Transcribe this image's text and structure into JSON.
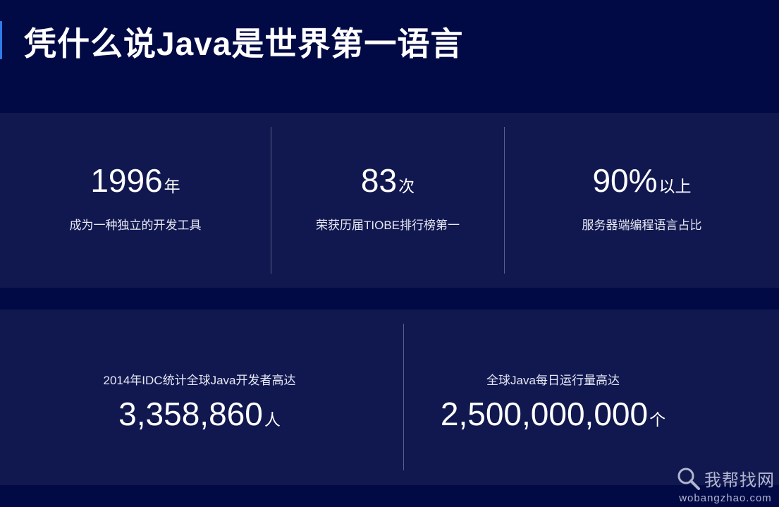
{
  "header": {
    "title": "凭什么说Java是世界第一语言"
  },
  "stats_top": [
    {
      "value": "1996",
      "unit": "年",
      "description": "成为一种独立的开发工具"
    },
    {
      "value": "83",
      "unit": "次",
      "description": "荣获历届TIOBE排行榜第一"
    },
    {
      "value": "90%",
      "unit": "以上",
      "description": "服务器端编程语言占比"
    }
  ],
  "stats_bottom": [
    {
      "description": "2014年IDC统计全球Java开发者高达",
      "value": "3,358,860",
      "unit": "人"
    },
    {
      "description": "全球Java每日运行量高达",
      "value": "2,500,000,000",
      "unit": "个"
    }
  ],
  "watermark": {
    "name": "我帮找网",
    "url": "wobangzhao.com",
    "icon": "magnifier-icon"
  },
  "colors": {
    "background": "#020a45",
    "panel": "#11184f",
    "accent": "#2f7bea",
    "divider": "#5a6088"
  }
}
